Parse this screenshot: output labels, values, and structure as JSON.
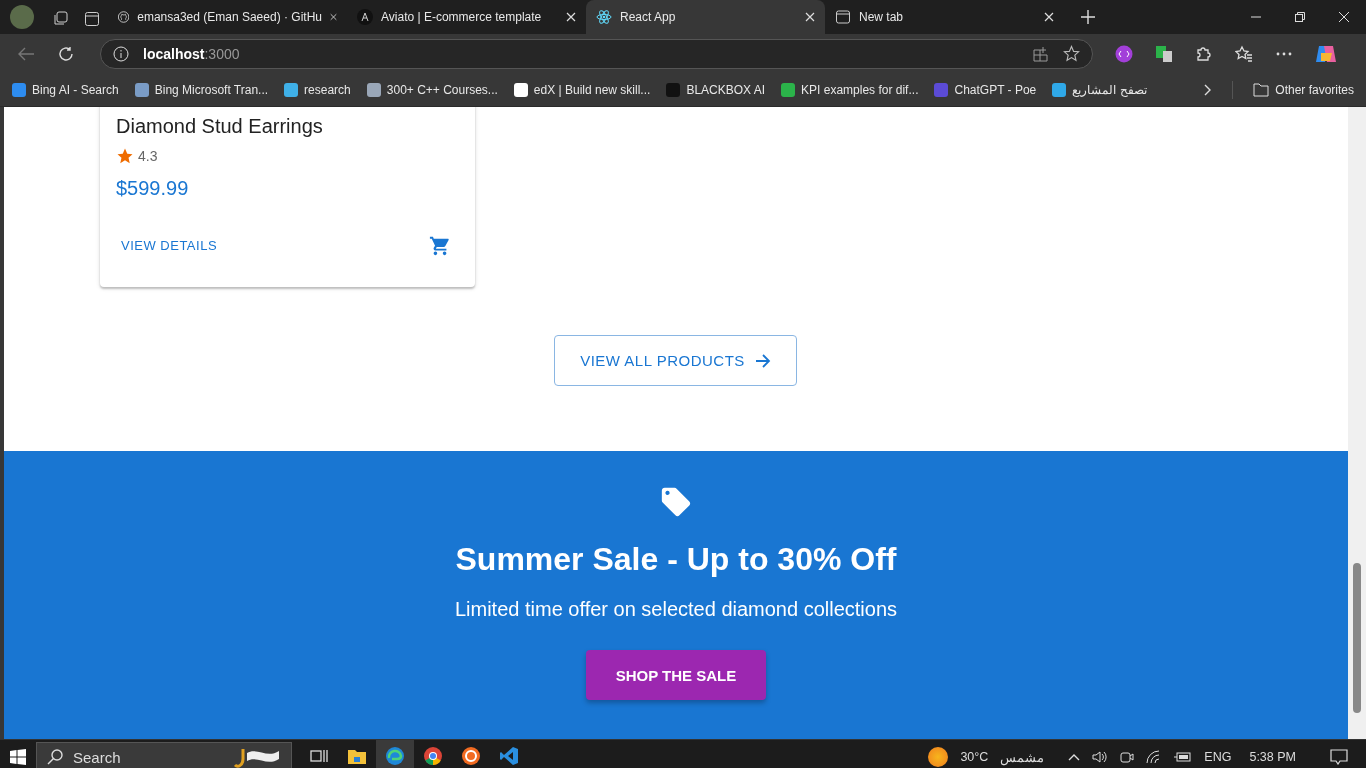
{
  "browser": {
    "tabs": [
      {
        "title": "emansa3ed (Eman Saeed) · GitHu",
        "kind": "github",
        "selected": false
      },
      {
        "title": "Aviato | E-commerce template",
        "kind": "letter",
        "selected": false
      },
      {
        "title": "React App",
        "kind": "react",
        "selected": true
      },
      {
        "title": "New tab",
        "kind": "page",
        "selected": false
      }
    ],
    "address": {
      "host": "localhost",
      "port": ":3000"
    },
    "bookmarks": [
      {
        "label": "Bing AI - Search",
        "color": "#2d8cf0"
      },
      {
        "label": "Bing Microsoft Tran...",
        "color": "#7a9cc6"
      },
      {
        "label": "research",
        "color": "#3fb0e8"
      },
      {
        "label": "300+ C++ Courses...",
        "color": "#9aa7b8"
      },
      {
        "label": "edX | Build new skill...",
        "color": "#ffffff"
      },
      {
        "label": "BLACKBOX AI",
        "color": "#111111"
      },
      {
        "label": "KPI examples for dif...",
        "color": "#2bb34a"
      },
      {
        "label": "ChatGPT - Poe",
        "color": "#5b4bd6"
      },
      {
        "label": "تصفح المشاريع",
        "color": "#2fa8e8"
      }
    ],
    "other_favorites": "Other favorites"
  },
  "product_card": {
    "name": "Diamond Stud Earrings",
    "rating": "4.3",
    "price": "$599.99",
    "action": "VIEW DETAILS"
  },
  "view_all_button": "VIEW ALL PRODUCTS",
  "sale_banner": {
    "title": "Summer Sale - Up to 30% Off",
    "subtitle": "Limited time offer on selected diamond collections",
    "button": "SHOP THE SALE"
  },
  "taskbar": {
    "search": "Search",
    "apps": [
      {
        "kind": "folder",
        "active": false
      },
      {
        "kind": "edge",
        "active": true
      },
      {
        "kind": "chrome",
        "active": false
      },
      {
        "kind": "orange",
        "active": false
      },
      {
        "kind": "code",
        "active": false
      }
    ],
    "weather_temp": "30°C",
    "weather_text": "مشمس",
    "language": "ENG",
    "time": "5:38 PM"
  }
}
